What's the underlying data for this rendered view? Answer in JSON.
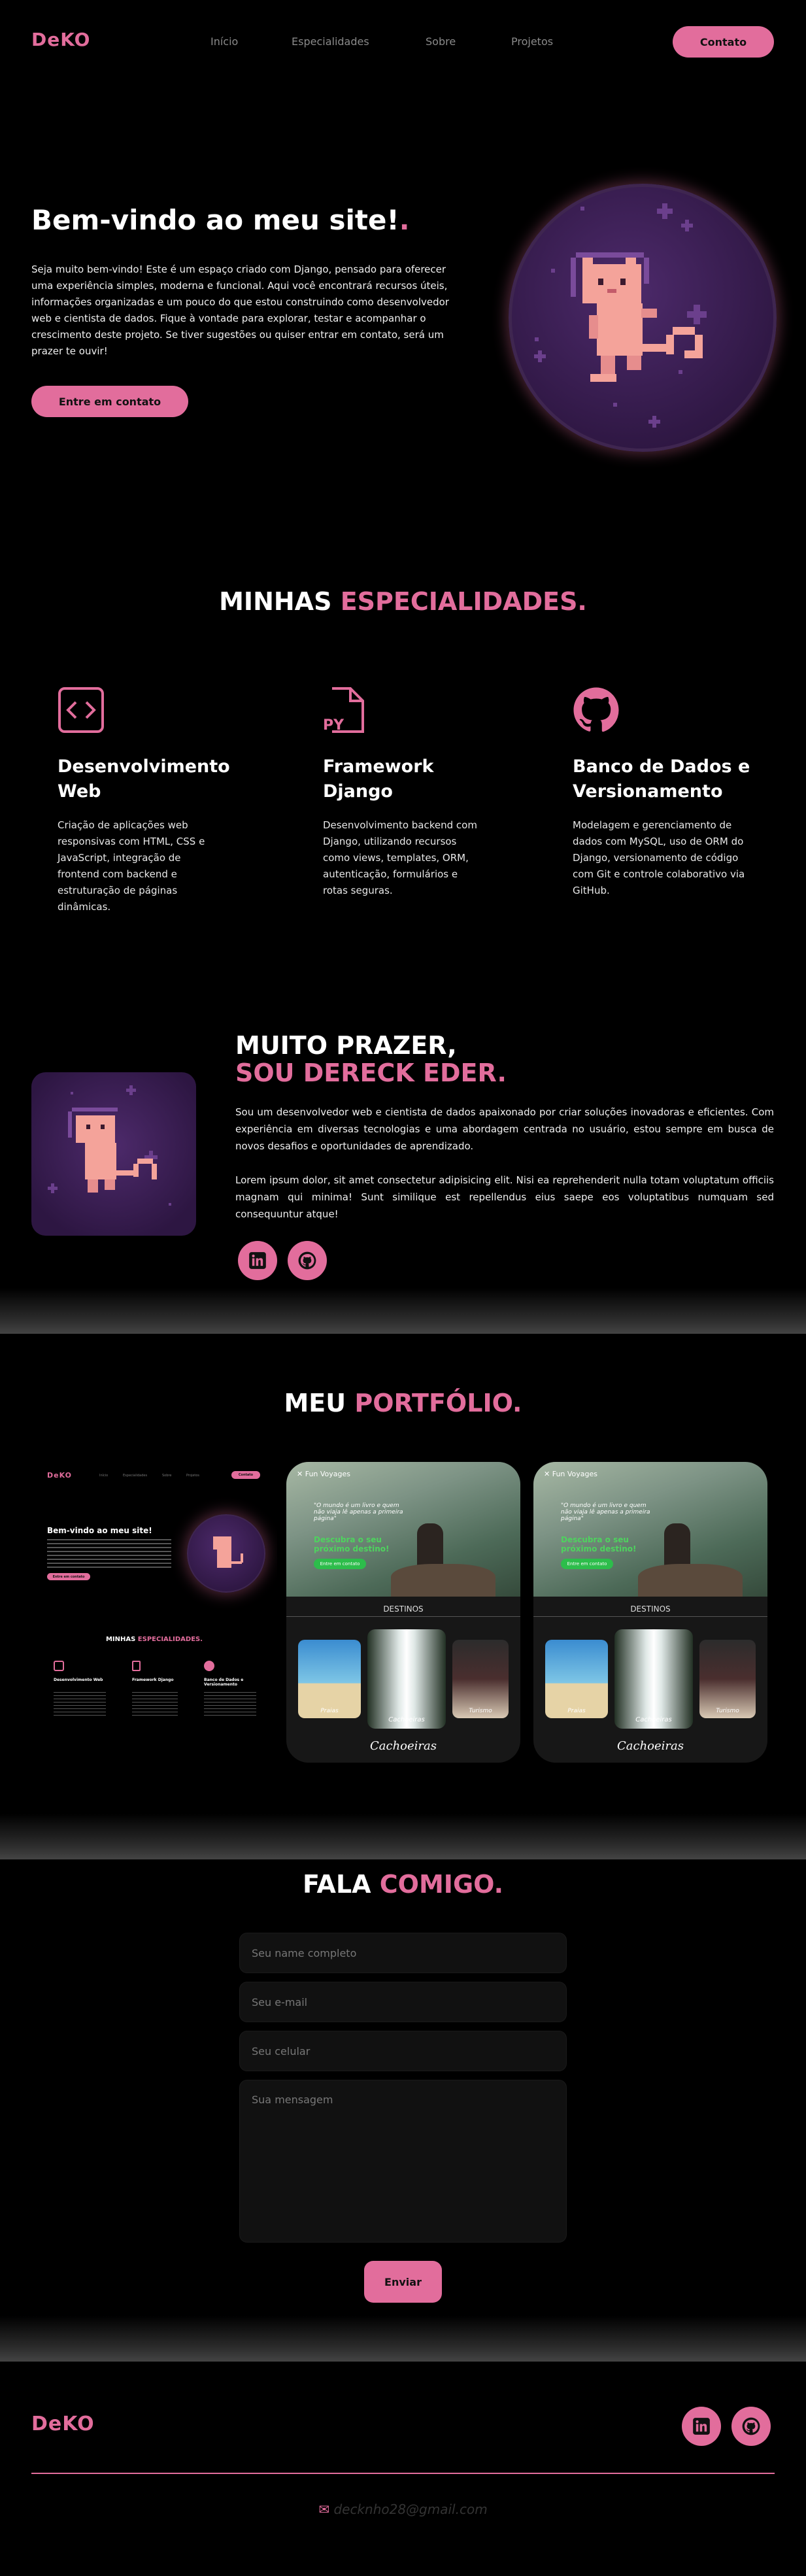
{
  "brand": {
    "logo": "DeKO",
    "accent": "#e26d9c"
  },
  "nav": {
    "items": [
      {
        "label": "Início"
      },
      {
        "label": "Especialidades"
      },
      {
        "label": "Sobre"
      },
      {
        "label": "Projetos"
      }
    ],
    "contact_button": "Contato"
  },
  "hero": {
    "title": "Bem-vindo ao meu site!",
    "title_dot": ".",
    "text": "Seja muito bem-vindo! Este é um espaço criado com Django, pensado para oferecer uma experiência simples, moderna e funcional. Aqui você encontrará recursos úteis, informações organizadas e um pouco do que estou construindo como desenvolvedor web e cientista de dados. Fique à vontade para explorar, testar e acompanhar o crescimento deste projeto. Se tiver sugestões ou quiser entrar em contato, será um prazer te ouvir!",
    "cta": "Entre em contato",
    "avatar_icon": "pixel-astronaut-cat-icon"
  },
  "specialties": {
    "title_white": "MINHAS ",
    "title_pink": "ESPECIALIDADES.",
    "items": [
      {
        "icon": "code-icon",
        "title": "Desenvolvimento Web",
        "text": "Criação de aplicações web responsivas com HTML, CSS e JavaScript, integração de frontend com backend e estruturação de páginas dinâmicas."
      },
      {
        "icon": "python-file-icon",
        "icon_label": "PY",
        "title": "Framework Django",
        "text": "Desenvolvimento backend com Django, utilizando recursos como views, templates, ORM, autenticação, formulários e rotas seguras."
      },
      {
        "icon": "github-icon",
        "title": "Banco de Dados e Versionamento",
        "text": "Modelagem e gerenciamento de dados com MySQL, uso de ORM do Django, versionamento de código com Git e controle colaborativo via GitHub."
      }
    ]
  },
  "about": {
    "title_white": "MUITO PRAZER,",
    "title_pink": "SOU DERECK EDER.",
    "paragraph1": "Sou um desenvolvedor web e cientista de dados apaixonado por criar soluções inovadoras e eficientes. Com experiência em diversas tecnologias e uma abordagem centrada no usuário, estou sempre em busca de novos desafios e oportunidades de aprendizado.",
    "paragraph2": "Lorem ipsum dolor, sit amet consectetur adipisicing elit. Nisi ea reprehenderit nulla totam voluptatum officiis magnam qui minima! Sunt similique est repellendus eius saepe eos voluptatibus numquam sed consequuntur atque!",
    "social": [
      {
        "icon": "linkedin-icon"
      },
      {
        "icon": "github-icon"
      }
    ]
  },
  "portfolio": {
    "title_white": "MEU ",
    "title_pink": "PORTFÓLIO.",
    "mini": {
      "logo": "DeKO",
      "nav": [
        "Início",
        "Especialidades",
        "Sobre",
        "Projetos"
      ],
      "btn": "Contato",
      "title": "Bem-vindo ao meu site!",
      "cta": "Entre em contato",
      "spec_title_white": "MINHAS ",
      "spec_title_pink": "ESPECIALIDADES.",
      "specs": [
        "Desenvolvimento Web",
        "Framework Django",
        "Banco de Dados e Versionamento"
      ]
    },
    "travel": {
      "brand": "Fun Voyages",
      "quote": "\"O mundo é um livro e quem não viaja lê apenas a primeira página\"",
      "cta_text": "Descubra o seu próximo destino!",
      "button": "Entre em contato",
      "section": "DESTINOS",
      "destinations": [
        "Praias",
        "Cachoeiras",
        "Turismo"
      ],
      "featured": "Cachoeiras"
    }
  },
  "contact": {
    "title_white": "FALA ",
    "title_pink": "COMIGO.",
    "name_placeholder": "Seu name completo",
    "email_placeholder": "Seu e-mail",
    "phone_placeholder": "Seu celular",
    "message_placeholder": "Sua mensagem",
    "submit": "Enviar"
  },
  "footer": {
    "logo": "DeKO",
    "email": "decknho28@gmail.com",
    "email_icon": "envelope-icon",
    "social": [
      {
        "icon": "linkedin-icon"
      },
      {
        "icon": "github-icon"
      }
    ]
  }
}
